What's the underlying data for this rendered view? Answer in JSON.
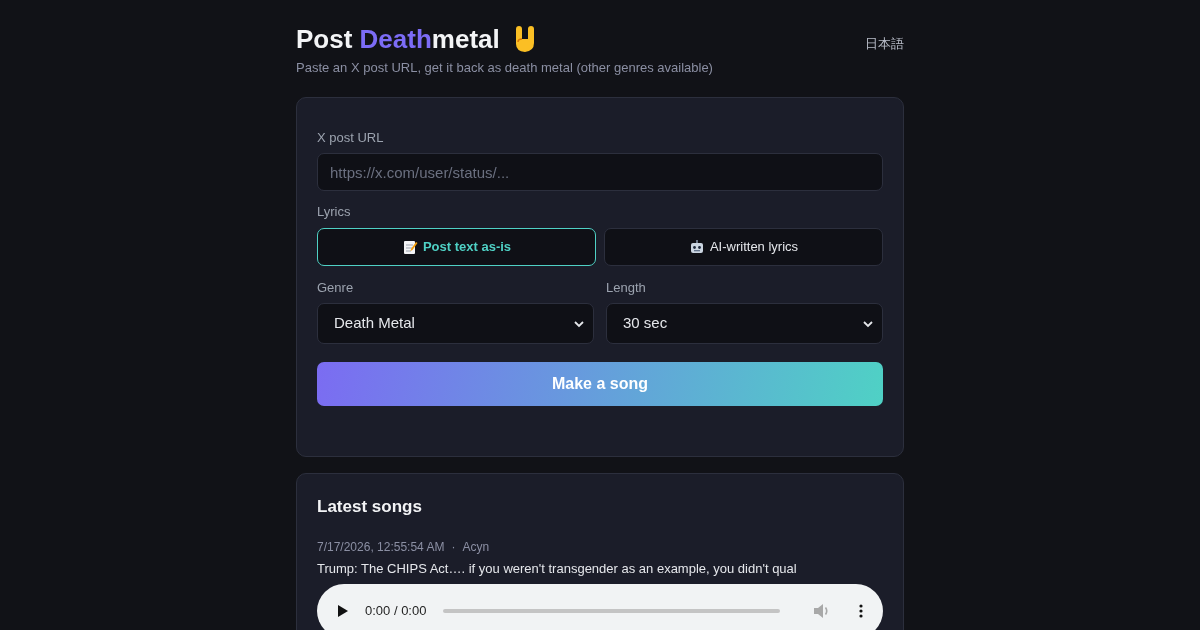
{
  "header": {
    "title": {
      "before": "Post ",
      "accent": "Death",
      "after": "metal"
    },
    "subtitle": "Paste an X post URL, get it back as death metal (other genres available)",
    "language_link": "日本語"
  },
  "form": {
    "url_label": "X post URL",
    "url_field": {
      "placeholder": "https://x.com/user/status/..."
    },
    "lyrics_label": "Lyrics",
    "lyrics_options": [
      {
        "kind": "memo",
        "label": "Post text as-is",
        "selected": true
      },
      {
        "kind": "robot",
        "label": "AI-written lyrics",
        "selected": false
      }
    ],
    "genre_label": "Genre",
    "genre_value": "Death Metal",
    "length_label": "Length",
    "length_value": "30 sec",
    "submit": "Make a song"
  },
  "latest": {
    "title": "Latest songs",
    "songs": [
      {
        "date": "7/17/2026, 12:55:54 AM",
        "separator": "·",
        "author": "Acyn",
        "text": "Trump: The CHIPS Act…. if you weren't transgender as an example, you didn't qual",
        "player": {
          "time": "0:00 / 0:00"
        }
      }
    ]
  }
}
